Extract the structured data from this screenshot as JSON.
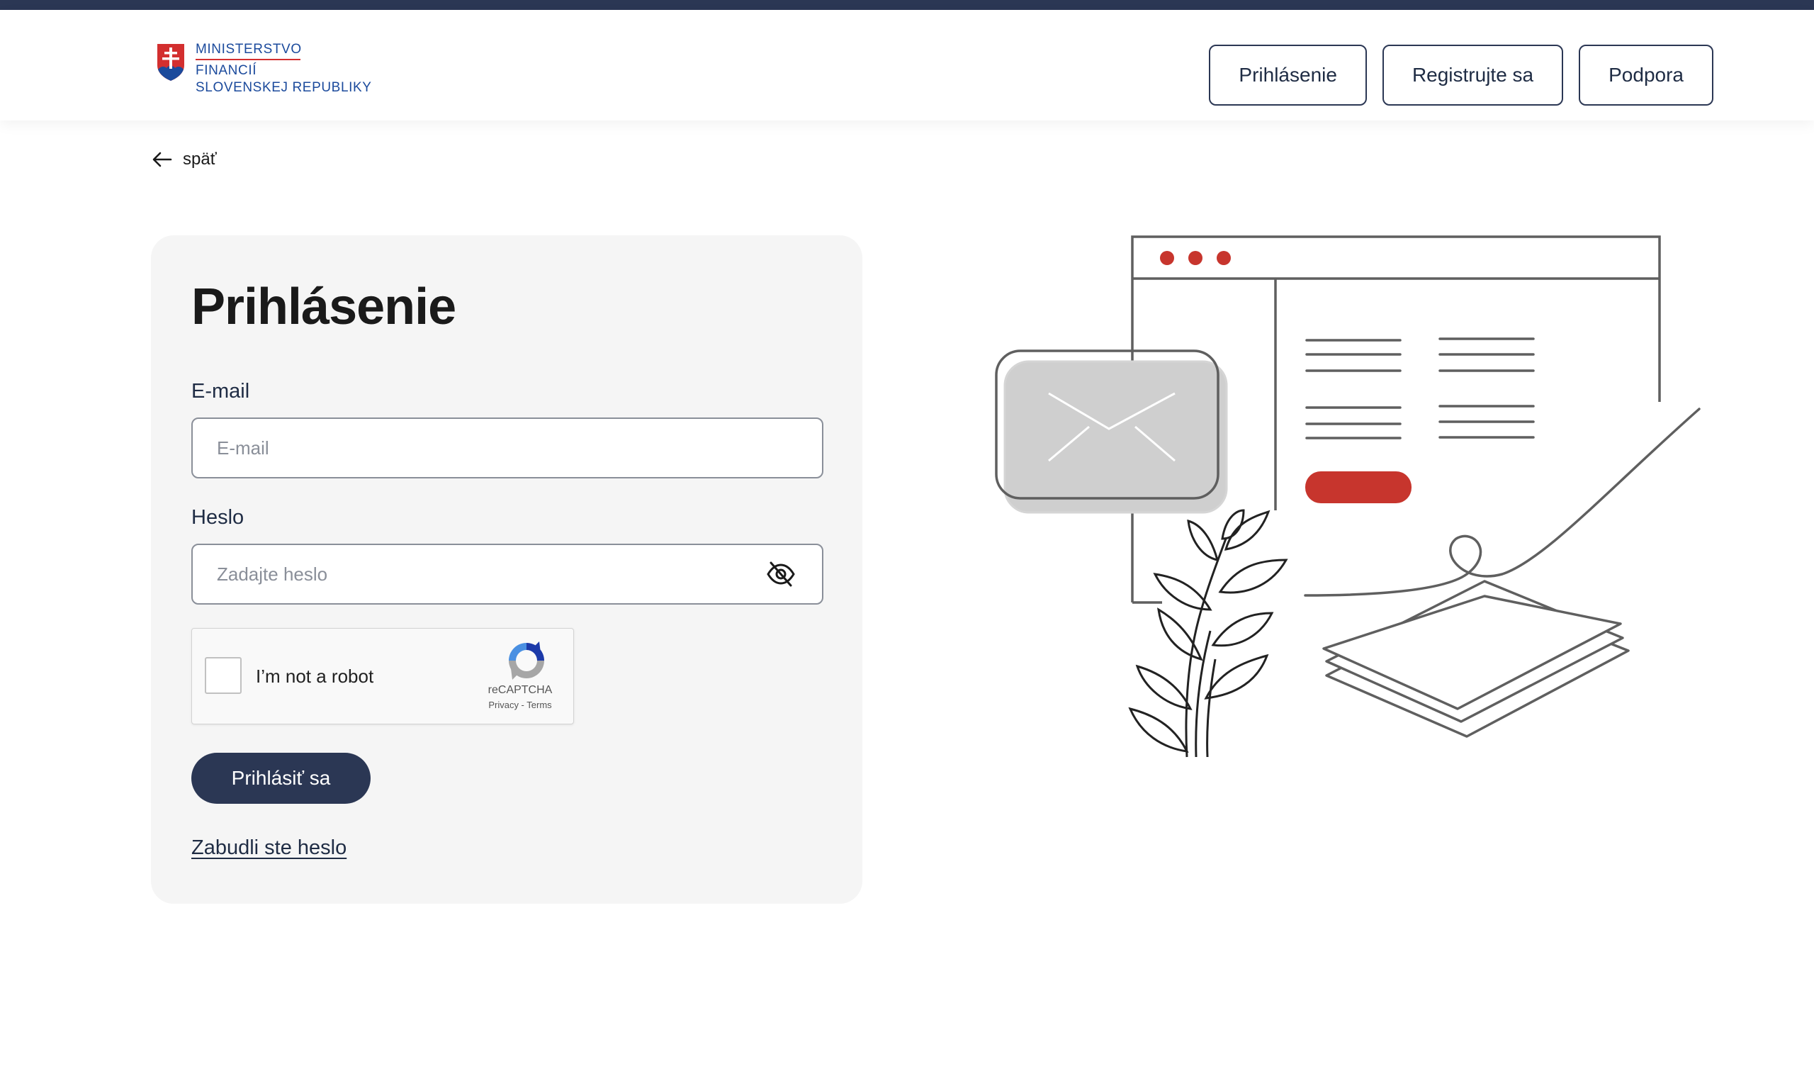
{
  "header": {
    "logo": {
      "line1": "MINISTERSTVO",
      "line2": "FINANCIÍ",
      "line3": "SLOVENSKEJ REPUBLIKY",
      "icon": "slovak-coat-of-arms-icon"
    },
    "nav": {
      "login": "Prihlásenie",
      "register": "Registrujte sa",
      "support": "Podpora"
    }
  },
  "back": {
    "label": "späť",
    "icon": "arrow-left-icon"
  },
  "form": {
    "title": "Prihlásenie",
    "email": {
      "label": "E-mail",
      "placeholder": "E-mail",
      "value": ""
    },
    "password": {
      "label": "Heslo",
      "placeholder": "Zadajte heslo",
      "value": "",
      "toggle_icon": "eye-off-icon"
    },
    "captcha": {
      "label": "I’m not a robot",
      "brand": "reCAPTCHA",
      "links": "Privacy - Terms",
      "checked": false
    },
    "submit": "Prihlásiť sa",
    "forgot": "Zabudli ste heslo"
  },
  "colors": {
    "primary": "#2b3754",
    "accent": "#c7352d",
    "card_bg": "#f5f5f5",
    "logo_blue": "#1b4a9c"
  }
}
